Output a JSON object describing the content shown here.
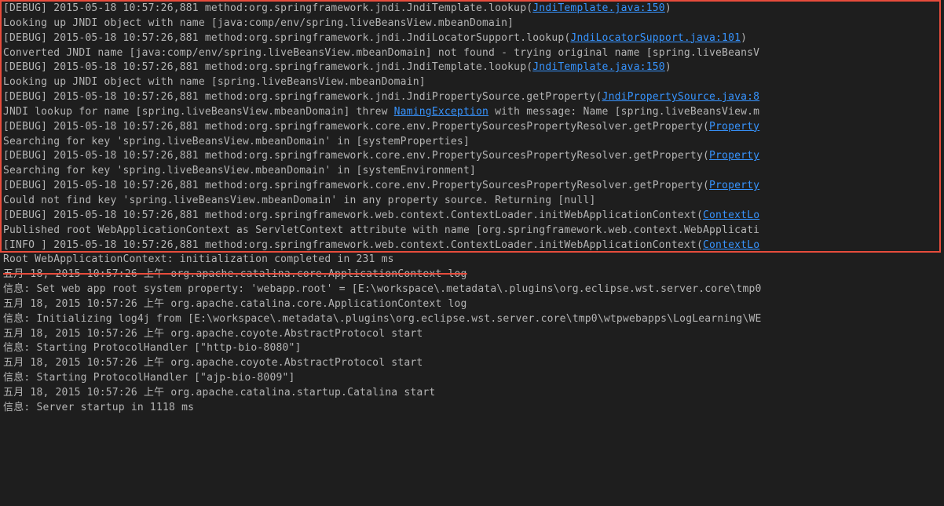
{
  "lines": [
    {
      "pre": "[",
      "level": "DEBUG",
      "post": "] 2015-05-18 10:57:26,881 method:org.springframework.jndi.JndiTemplate.lookup(",
      "link": "JndiTemplate.java:150",
      "after": ")"
    },
    {
      "text": "Looking up JNDI object with name [java:comp/env/spring.liveBeansView.mbeanDomain]"
    },
    {
      "pre": "[",
      "level": "DEBUG",
      "post": "] 2015-05-18 10:57:26,881 method:org.springframework.jndi.JndiLocatorSupport.lookup(",
      "link": "JndiLocatorSupport.java:101",
      "after": ")"
    },
    {
      "text": "Converted JNDI name [java:comp/env/spring.liveBeansView.mbeanDomain] not found - trying original name [spring.liveBeansV"
    },
    {
      "pre": "[",
      "level": "DEBUG",
      "post": "] 2015-05-18 10:57:26,881 method:org.springframework.jndi.JndiTemplate.lookup(",
      "link": "JndiTemplate.java:150",
      "after": ")"
    },
    {
      "text": "Looking up JNDI object with name [spring.liveBeansView.mbeanDomain]"
    },
    {
      "pre": "[",
      "level": "DEBUG",
      "post": "] 2015-05-18 10:57:26,881 method:org.springframework.jndi.JndiPropertySource.getProperty(",
      "link": "JndiPropertySource.java:8",
      "after": ""
    },
    {
      "textpre": "JNDI lookup for name [spring.liveBeansView.mbeanDomain] threw ",
      "link": "NamingException",
      "textpost": " with message: Name [spring.liveBeansView.m"
    },
    {
      "pre": "[",
      "level": "DEBUG",
      "post": "] 2015-05-18 10:57:26,881 method:org.springframework.core.env.PropertySourcesPropertyResolver.getProperty(",
      "link": "Property",
      "after": ""
    },
    {
      "text": "Searching for key 'spring.liveBeansView.mbeanDomain' in [systemProperties]"
    },
    {
      "pre": "[",
      "level": "DEBUG",
      "post": "] 2015-05-18 10:57:26,881 method:org.springframework.core.env.PropertySourcesPropertyResolver.getProperty(",
      "link": "Property",
      "after": ""
    },
    {
      "text": "Searching for key 'spring.liveBeansView.mbeanDomain' in [systemEnvironment]"
    },
    {
      "pre": "[",
      "level": "DEBUG",
      "post": "] 2015-05-18 10:57:26,881 method:org.springframework.core.env.PropertySourcesPropertyResolver.getProperty(",
      "link": "Property",
      "after": ""
    },
    {
      "text": "Could not find key 'spring.liveBeansView.mbeanDomain' in any property source. Returning [null]"
    },
    {
      "pre": "[",
      "level": "DEBUG",
      "post": "] 2015-05-18 10:57:26,881 method:org.springframework.web.context.ContextLoader.initWebApplicationContext(",
      "link": "ContextLo",
      "after": ""
    },
    {
      "text": "Published root WebApplicationContext as ServletContext attribute with name [org.springframework.web.context.WebApplicati"
    },
    {
      "pre": "[",
      "level": "INFO ",
      "post": "] 2015-05-18 10:57:26,881 method:org.springframework.web.context.ContextLoader.initWebApplicationContext(",
      "link": "ContextLo",
      "after": ""
    },
    {
      "text": "Root WebApplicationContext: initialization completed in 231 ms"
    },
    {
      "strike": "五月 18, 2015 10:57:26 上午 org.apache.catalina.core.ApplicationContext log"
    },
    {
      "text": "信息: Set web app root system property: 'webapp.root' = [E:\\workspace\\.metadata\\.plugins\\org.eclipse.wst.server.core\\tmp0"
    },
    {
      "text": "五月 18, 2015 10:57:26 上午 org.apache.catalina.core.ApplicationContext log"
    },
    {
      "text": "信息: Initializing log4j from [E:\\workspace\\.metadata\\.plugins\\org.eclipse.wst.server.core\\tmp0\\wtpwebapps\\LogLearning\\WE"
    },
    {
      "text": "五月 18, 2015 10:57:26 上午 org.apache.coyote.AbstractProtocol start"
    },
    {
      "text": "信息: Starting ProtocolHandler [\"http-bio-8080\"]"
    },
    {
      "text": "五月 18, 2015 10:57:26 上午 org.apache.coyote.AbstractProtocol start"
    },
    {
      "text": "信息: Starting ProtocolHandler [\"ajp-bio-8009\"]"
    },
    {
      "text": "五月 18, 2015 10:57:26 上午 org.apache.catalina.startup.Catalina start"
    },
    {
      "text": "信息: Server startup in 1118 ms"
    }
  ]
}
